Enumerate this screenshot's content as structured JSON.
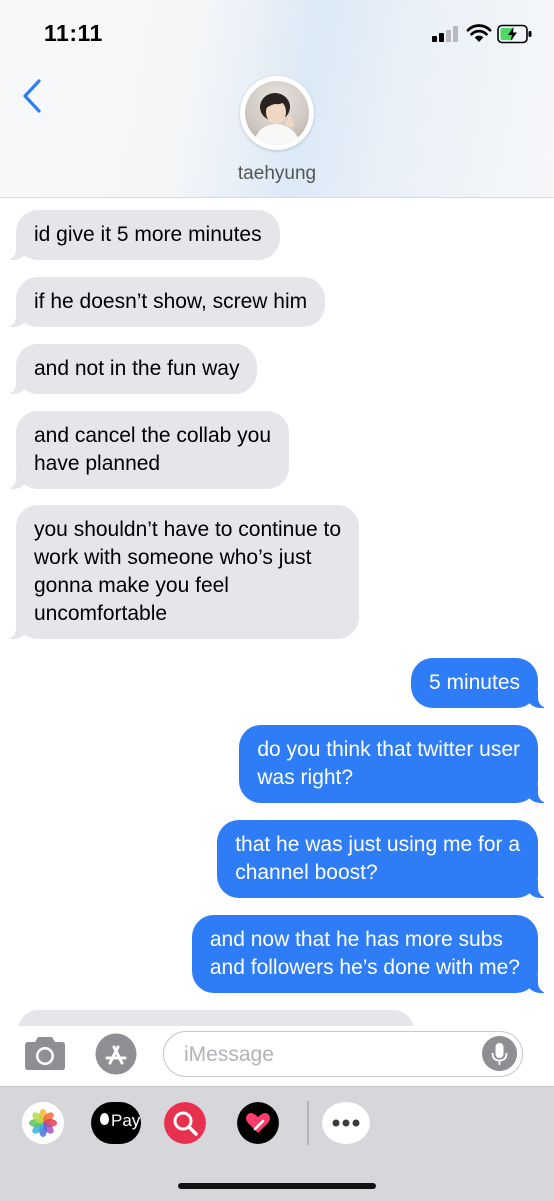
{
  "status_bar": {
    "time": "11:11"
  },
  "header": {
    "contact_name": "taehyung"
  },
  "messages": [
    {
      "from": "them",
      "text": "id give it 5 more minutes"
    },
    {
      "from": "them",
      "text": "if he doesn’t show, screw him"
    },
    {
      "from": "them",
      "text": "and not in the fun way"
    },
    {
      "from": "them",
      "text": "and cancel the collab you\nhave planned"
    },
    {
      "from": "them",
      "text": "you shouldn’t have to continue to\nwork with someone who’s just\ngonna make you feel\nuncomfortable"
    },
    {
      "from": "me",
      "text": "5 minutes"
    },
    {
      "from": "me",
      "text": "do you think that twitter user\nwas right?"
    },
    {
      "from": "me",
      "text": "that he was just using me for a\nchannel boost?"
    },
    {
      "from": "me",
      "text": "and now that he has more subs\nand followers he’s done with me?"
    }
  ],
  "input": {
    "placeholder": "iMessage"
  },
  "drawer": {
    "apple_pay_label": "Pay",
    "apps": [
      "photos-icon",
      "apple-pay-icon",
      "search-images-icon",
      "digital-touch-icon",
      "more-icon"
    ]
  },
  "colors": {
    "outgoing": "#2f7df6",
    "incoming": "#e5e5ea",
    "header_tint": "#dce9f7"
  }
}
